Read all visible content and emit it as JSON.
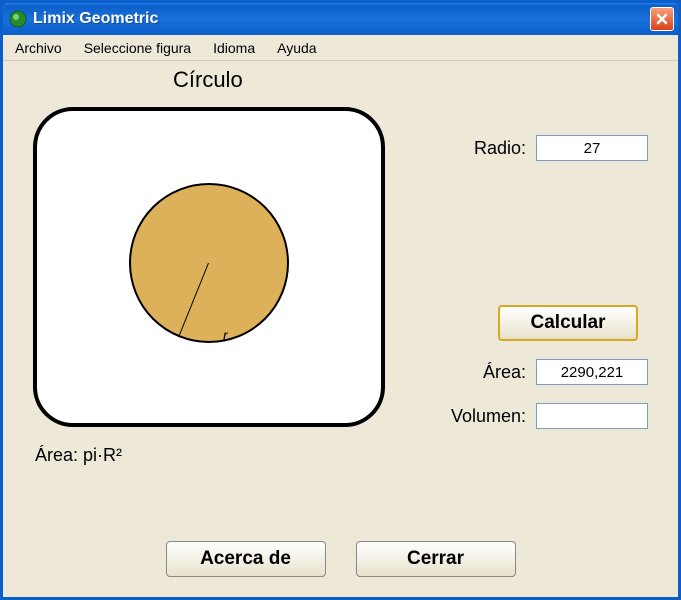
{
  "window": {
    "title": "Limix Geometric"
  },
  "menu": {
    "file": "Archivo",
    "select_shape": "Seleccione figura",
    "language": "Idioma",
    "help": "Ayuda"
  },
  "shape": {
    "title": "Círculo",
    "radius_letter": "r",
    "formula": "Área: pi·R²"
  },
  "fields": {
    "radio_label": "Radio:",
    "radio_value": "27",
    "area_label": "Área:",
    "area_value": "2290,221",
    "volume_label": "Volumen:",
    "volume_value": ""
  },
  "buttons": {
    "calculate": "Calcular",
    "about": "Acerca de",
    "close": "Cerrar"
  }
}
